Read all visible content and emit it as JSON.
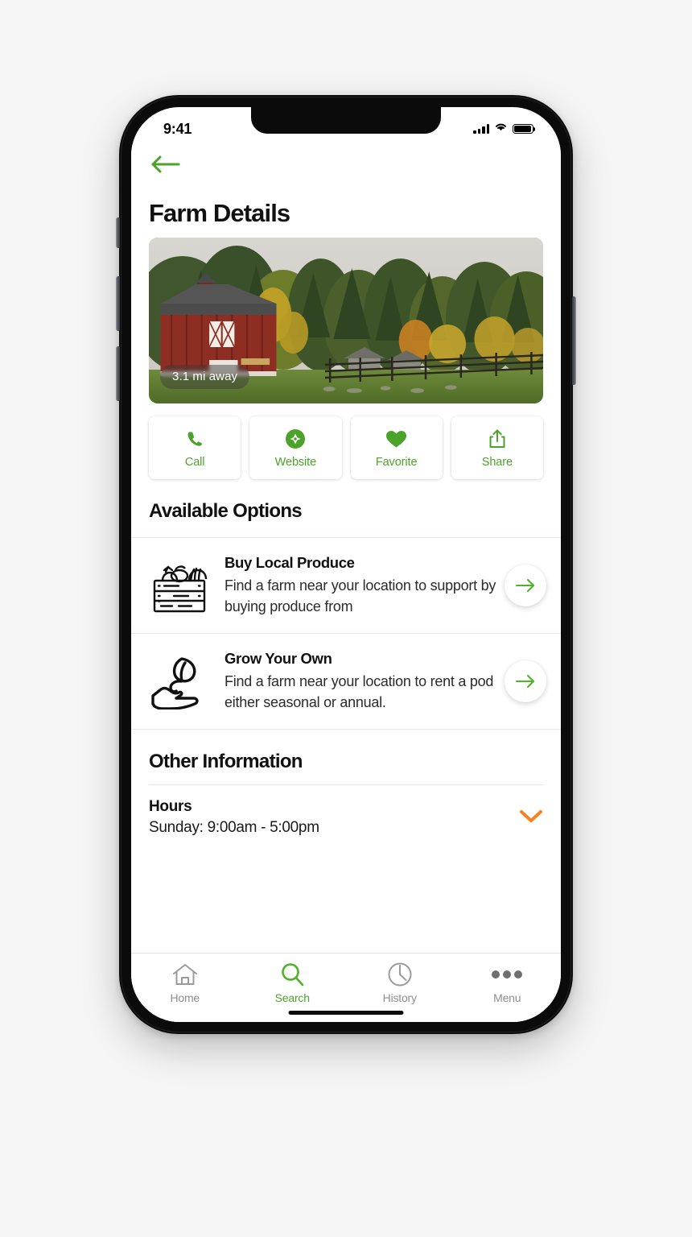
{
  "colors": {
    "green": "#4CA32A",
    "green_bright": "#4FB22B",
    "orange": "#F5821F",
    "text_dark": "#111111",
    "text_muted": "#8e8e8e",
    "frame": "#0b0b0c"
  },
  "status_bar": {
    "time": "9:41",
    "signal_icon": "cellular-signal-icon",
    "wifi_icon": "wifi-icon",
    "battery_icon": "battery-full-icon"
  },
  "nav": {
    "back_icon": "arrow-left-icon"
  },
  "header": {
    "title": "Farm Details"
  },
  "hero": {
    "image_alt": "red-barn-autumn-trees-photo",
    "distance_badge": "3.1 mi away"
  },
  "actions": [
    {
      "label": "Call",
      "icon": "phone-icon"
    },
    {
      "label": "Website",
      "icon": "compass-icon"
    },
    {
      "label": "Favorite",
      "icon": "heart-icon"
    },
    {
      "label": "Share",
      "icon": "share-icon"
    }
  ],
  "available_options": {
    "heading": "Available Options",
    "items": [
      {
        "title": "Buy Local Produce",
        "description": "Find a farm near your location to support by buying produce from",
        "icon": "produce-crate-icon",
        "arrow_icon": "arrow-right-icon"
      },
      {
        "title": "Grow Your Own",
        "description": "Find a farm near your location to rent a pod either seasonal or annual.",
        "icon": "hand-sprout-icon",
        "arrow_icon": "arrow-right-icon"
      }
    ]
  },
  "other_information": {
    "heading": "Other Information",
    "hours": {
      "label": "Hours",
      "value": "Sunday: 9:00am - 5:00pm",
      "chevron_icon": "chevron-down-icon"
    }
  },
  "tabbar": {
    "items": [
      {
        "label": "Home",
        "icon": "home-icon",
        "active": false
      },
      {
        "label": "Search",
        "icon": "search-icon",
        "active": true
      },
      {
        "label": "History",
        "icon": "clock-icon",
        "active": false
      },
      {
        "label": "Menu",
        "icon": "ellipsis-icon",
        "active": false
      }
    ]
  }
}
